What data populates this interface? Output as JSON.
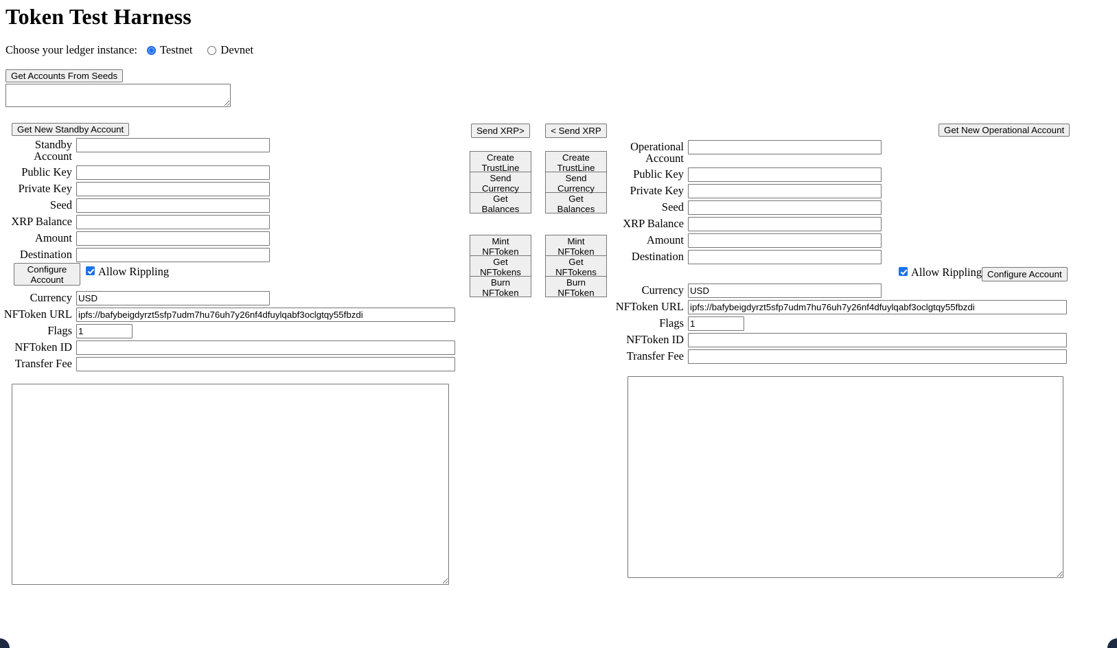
{
  "page": {
    "title": "Token Test Harness"
  },
  "ledger": {
    "prompt": "Choose your ledger instance:",
    "options": [
      {
        "label": "Testnet",
        "selected": true
      },
      {
        "label": "Devnet",
        "selected": false
      }
    ]
  },
  "seeds": {
    "button_label": "Get Accounts From Seeds",
    "textarea_value": "",
    "textarea_placeholder": ""
  },
  "standby": {
    "new_account_button": "Get New Standby Account",
    "fields": [
      {
        "label": "Standby Account",
        "value": ""
      },
      {
        "label": "Public Key",
        "value": ""
      },
      {
        "label": "Private Key",
        "value": ""
      },
      {
        "label": "Seed",
        "value": ""
      },
      {
        "label": "XRP Balance",
        "value": ""
      },
      {
        "label": "Amount",
        "value": ""
      },
      {
        "label": "Destination",
        "value": ""
      }
    ],
    "configure_button": "Configure\nAccount",
    "allow_rippling_label": "Allow Rippling",
    "allow_rippling_checked": true,
    "token_fields": [
      {
        "label": "Currency",
        "value": "USD"
      },
      {
        "label": "NFToken URL",
        "value": "ipfs://bafybeigdyrzt5sfp7udm7hu76uh7y26nf4dfuylqabf3oclgtqy55fbzdi"
      },
      {
        "label": "Flags",
        "value": "1"
      },
      {
        "label": "NFToken ID",
        "value": ""
      },
      {
        "label": "Transfer Fee",
        "value": ""
      }
    ],
    "results_value": ""
  },
  "center": {
    "left_column": {
      "send_xrp": "Send XRP>",
      "group_one": [
        "Create\nTrustLine",
        "Send\nCurrency",
        "Get\nBalances"
      ],
      "group_two": [
        "Mint\nNFToken",
        "Get\nNFTokens",
        "Burn\nNFToken"
      ]
    },
    "right_column": {
      "send_xrp": "< Send XRP",
      "group_one": [
        "Create\nTrustLine",
        "Send\nCurrency",
        "Get\nBalances"
      ],
      "group_two": [
        "Mint\nNFToken",
        "Get\nNFTokens",
        "Burn\nNFToken"
      ]
    }
  },
  "operational": {
    "new_account_button": "Get New Operational Account",
    "fields": [
      {
        "label": "Operational Account",
        "value": ""
      },
      {
        "label": "Public Key",
        "value": ""
      },
      {
        "label": "Private Key",
        "value": ""
      },
      {
        "label": "Seed",
        "value": ""
      },
      {
        "label": "XRP Balance",
        "value": ""
      },
      {
        "label": "Amount",
        "value": ""
      },
      {
        "label": "Destination",
        "value": ""
      }
    ],
    "configure_button": "Configure Account",
    "allow_rippling_label": "Allow Rippling",
    "allow_rippling_checked": true,
    "token_fields": [
      {
        "label": "Currency",
        "value": "USD"
      },
      {
        "label": "NFToken URL",
        "value": "ipfs://bafybeigdyrzt5sfp7udm7hu76uh7y26nf4dfuylqabf3oclgtqy55fbzdi"
      },
      {
        "label": "Flags",
        "value": "1"
      },
      {
        "label": "NFToken ID",
        "value": ""
      },
      {
        "label": "Transfer Fee",
        "value": ""
      }
    ],
    "results_value": ""
  },
  "colors": {
    "accent": "#1a73e8",
    "control_border": "#767676",
    "button_face": "#efefef",
    "window_chrome": "#1d2a42"
  }
}
